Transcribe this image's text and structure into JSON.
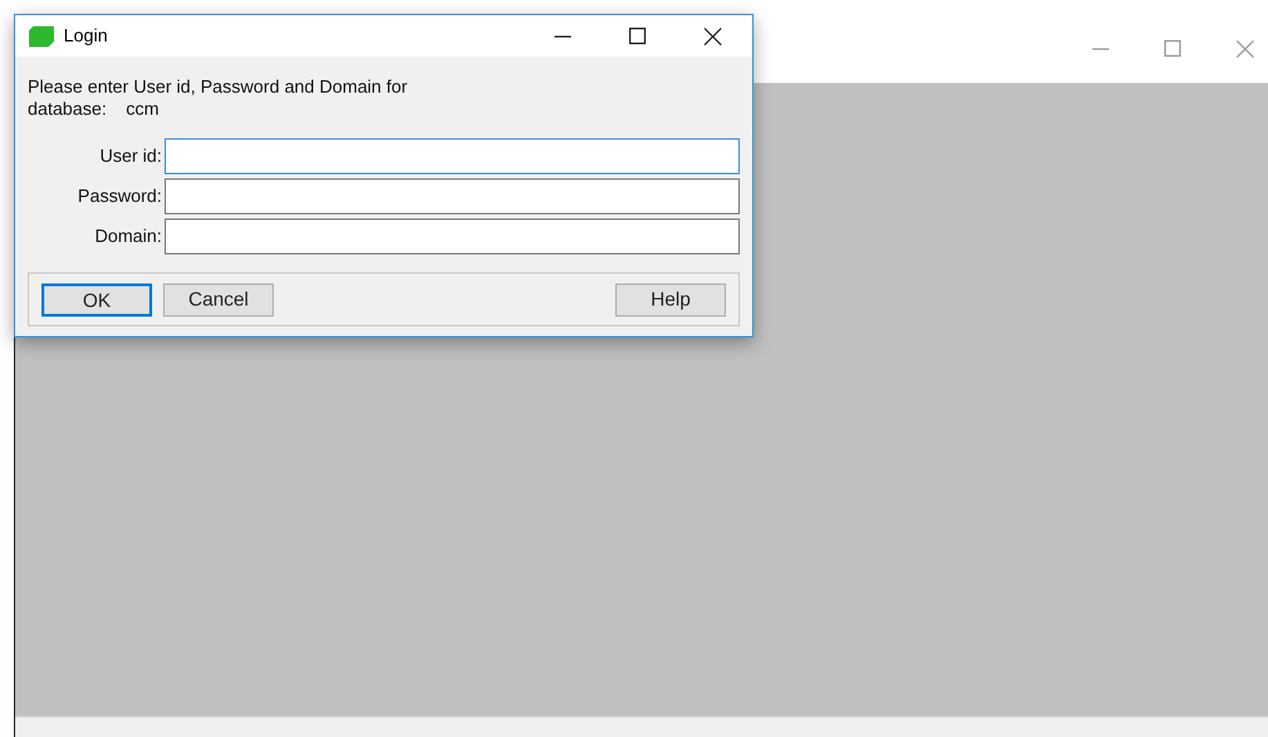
{
  "dialog": {
    "title": "Login",
    "message": "Please enter User id, Password and Domain for",
    "database_label": "database:",
    "database_value": "ccm",
    "fields": [
      {
        "label": "User id:",
        "focused": true
      },
      {
        "label": "Password:",
        "focused": false
      },
      {
        "label": "Domain:",
        "focused": false
      }
    ],
    "buttons": [
      {
        "label": "OK",
        "default": true
      },
      {
        "label": "Cancel",
        "default": false
      }
    ],
    "side_buttons": [
      {
        "label": "Help",
        "default": false
      }
    ]
  }
}
